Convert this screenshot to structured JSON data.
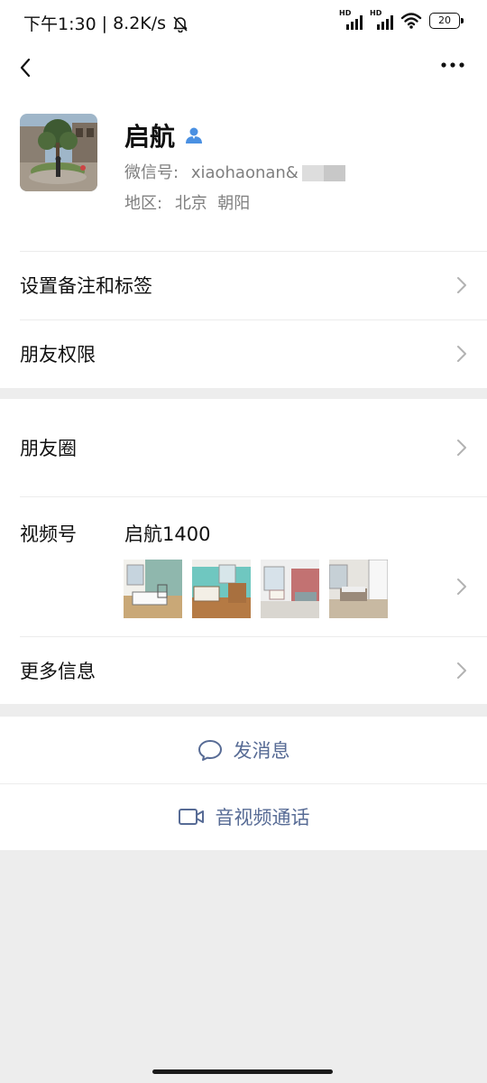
{
  "status_bar": {
    "time": "下午1:30",
    "separator": "|",
    "speed": "8.2K/s",
    "signal_label_1": "HD",
    "signal_label_2": "HD",
    "battery": "20"
  },
  "nav": {
    "back_icon": "back-arrow-icon",
    "more_icon": "more-dots-icon"
  },
  "profile": {
    "name": "启航",
    "wechat_id_label": "微信号:",
    "wechat_id_value": "xiaohaonan&",
    "region_label": "地区:",
    "region_value": "北京  朝阳"
  },
  "settings": {
    "remark_tags": "设置备注和标签",
    "friend_permissions": "朋友权限"
  },
  "info": {
    "moments": "朋友圈",
    "channels_label": "视频号",
    "channels_name": "启航1400",
    "more_info": "更多信息"
  },
  "actions": {
    "send_message": "发消息",
    "video_call": "音视频通话"
  },
  "colors": {
    "link": "#576b95",
    "background": "#ededed",
    "verified_icon": "#4a90e2"
  }
}
